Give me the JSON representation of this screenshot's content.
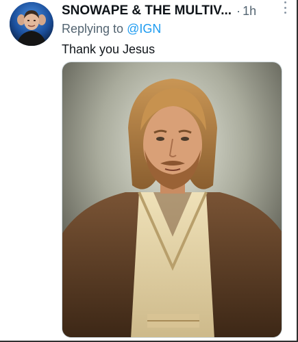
{
  "tweet": {
    "author_name": "SNOWAPE & THE MULTIV...",
    "separator": "·",
    "timestamp": "1h",
    "reply_prefix": "Replying to",
    "reply_handle": "@IGN",
    "text": "Thank you Jesus"
  },
  "icons": {
    "more": "more-vertical-icon"
  },
  "colors": {
    "link": "#1d9bf0",
    "secondary_text": "#536471",
    "primary_text": "#0f1419"
  }
}
